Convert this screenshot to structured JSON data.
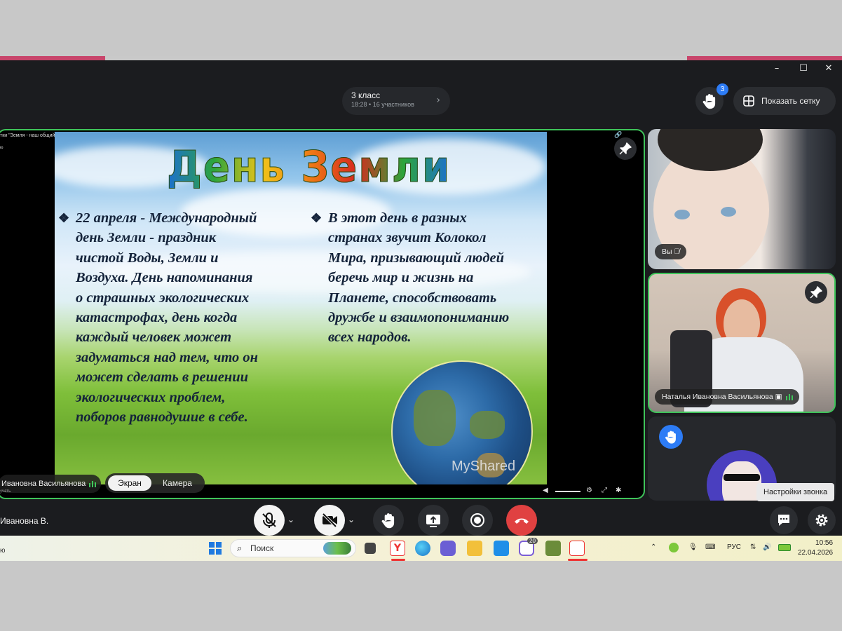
{
  "conference": {
    "title": "3 класс",
    "time": "18:28",
    "participants": "16 участников"
  },
  "header": {
    "raised_hands_count": "3",
    "show_grid_label": "Показать сетку"
  },
  "presentation": {
    "doc_title": "тки \"Земля - наш общий дом\"",
    "doc_sub": "ю",
    "slide_title": "День Земли",
    "left_column": [
      "22 апреля - Международный",
      "день Земли - праздник",
      "чистой Воды, Земли и",
      "Воздуха. День напоминания",
      "о страшных экологических",
      "катастрофах, день когда",
      "каждый человек может",
      "задуматься над тем, что он",
      "может сделать в решении",
      "экологических проблем,",
      "поборов равнодушие в себе."
    ],
    "right_column": [
      "В этот день в разных",
      "странах звучит Колокол",
      "Мира, призывающий людей",
      "беречь мир и жизнь на",
      "Планете, способствовать",
      "дружбе и взаимопониманию",
      "всех народов."
    ],
    "watermark": "MyShared",
    "presenter_chip": "Ивановна Васильянова",
    "source_tiny": "учать"
  },
  "view_toggle": {
    "screen": "Экран",
    "camera": "Камера"
  },
  "tiles": {
    "self_label": "Вы",
    "teacher_label": "Наталья Ивановна Васильянова"
  },
  "tooltip": "Настройки звонка",
  "bottom": {
    "self_name": "Ивановна В."
  },
  "taskbar": {
    "search_placeholder": "Поиск",
    "lang": "РУС",
    "time": "10:56",
    "date": "22.04.2026",
    "left_text": "ю",
    "notif_badge": "20"
  },
  "colors": {
    "active_border": "#3fc45a",
    "accent": "#2d7cf6",
    "end_call": "#e04141"
  }
}
